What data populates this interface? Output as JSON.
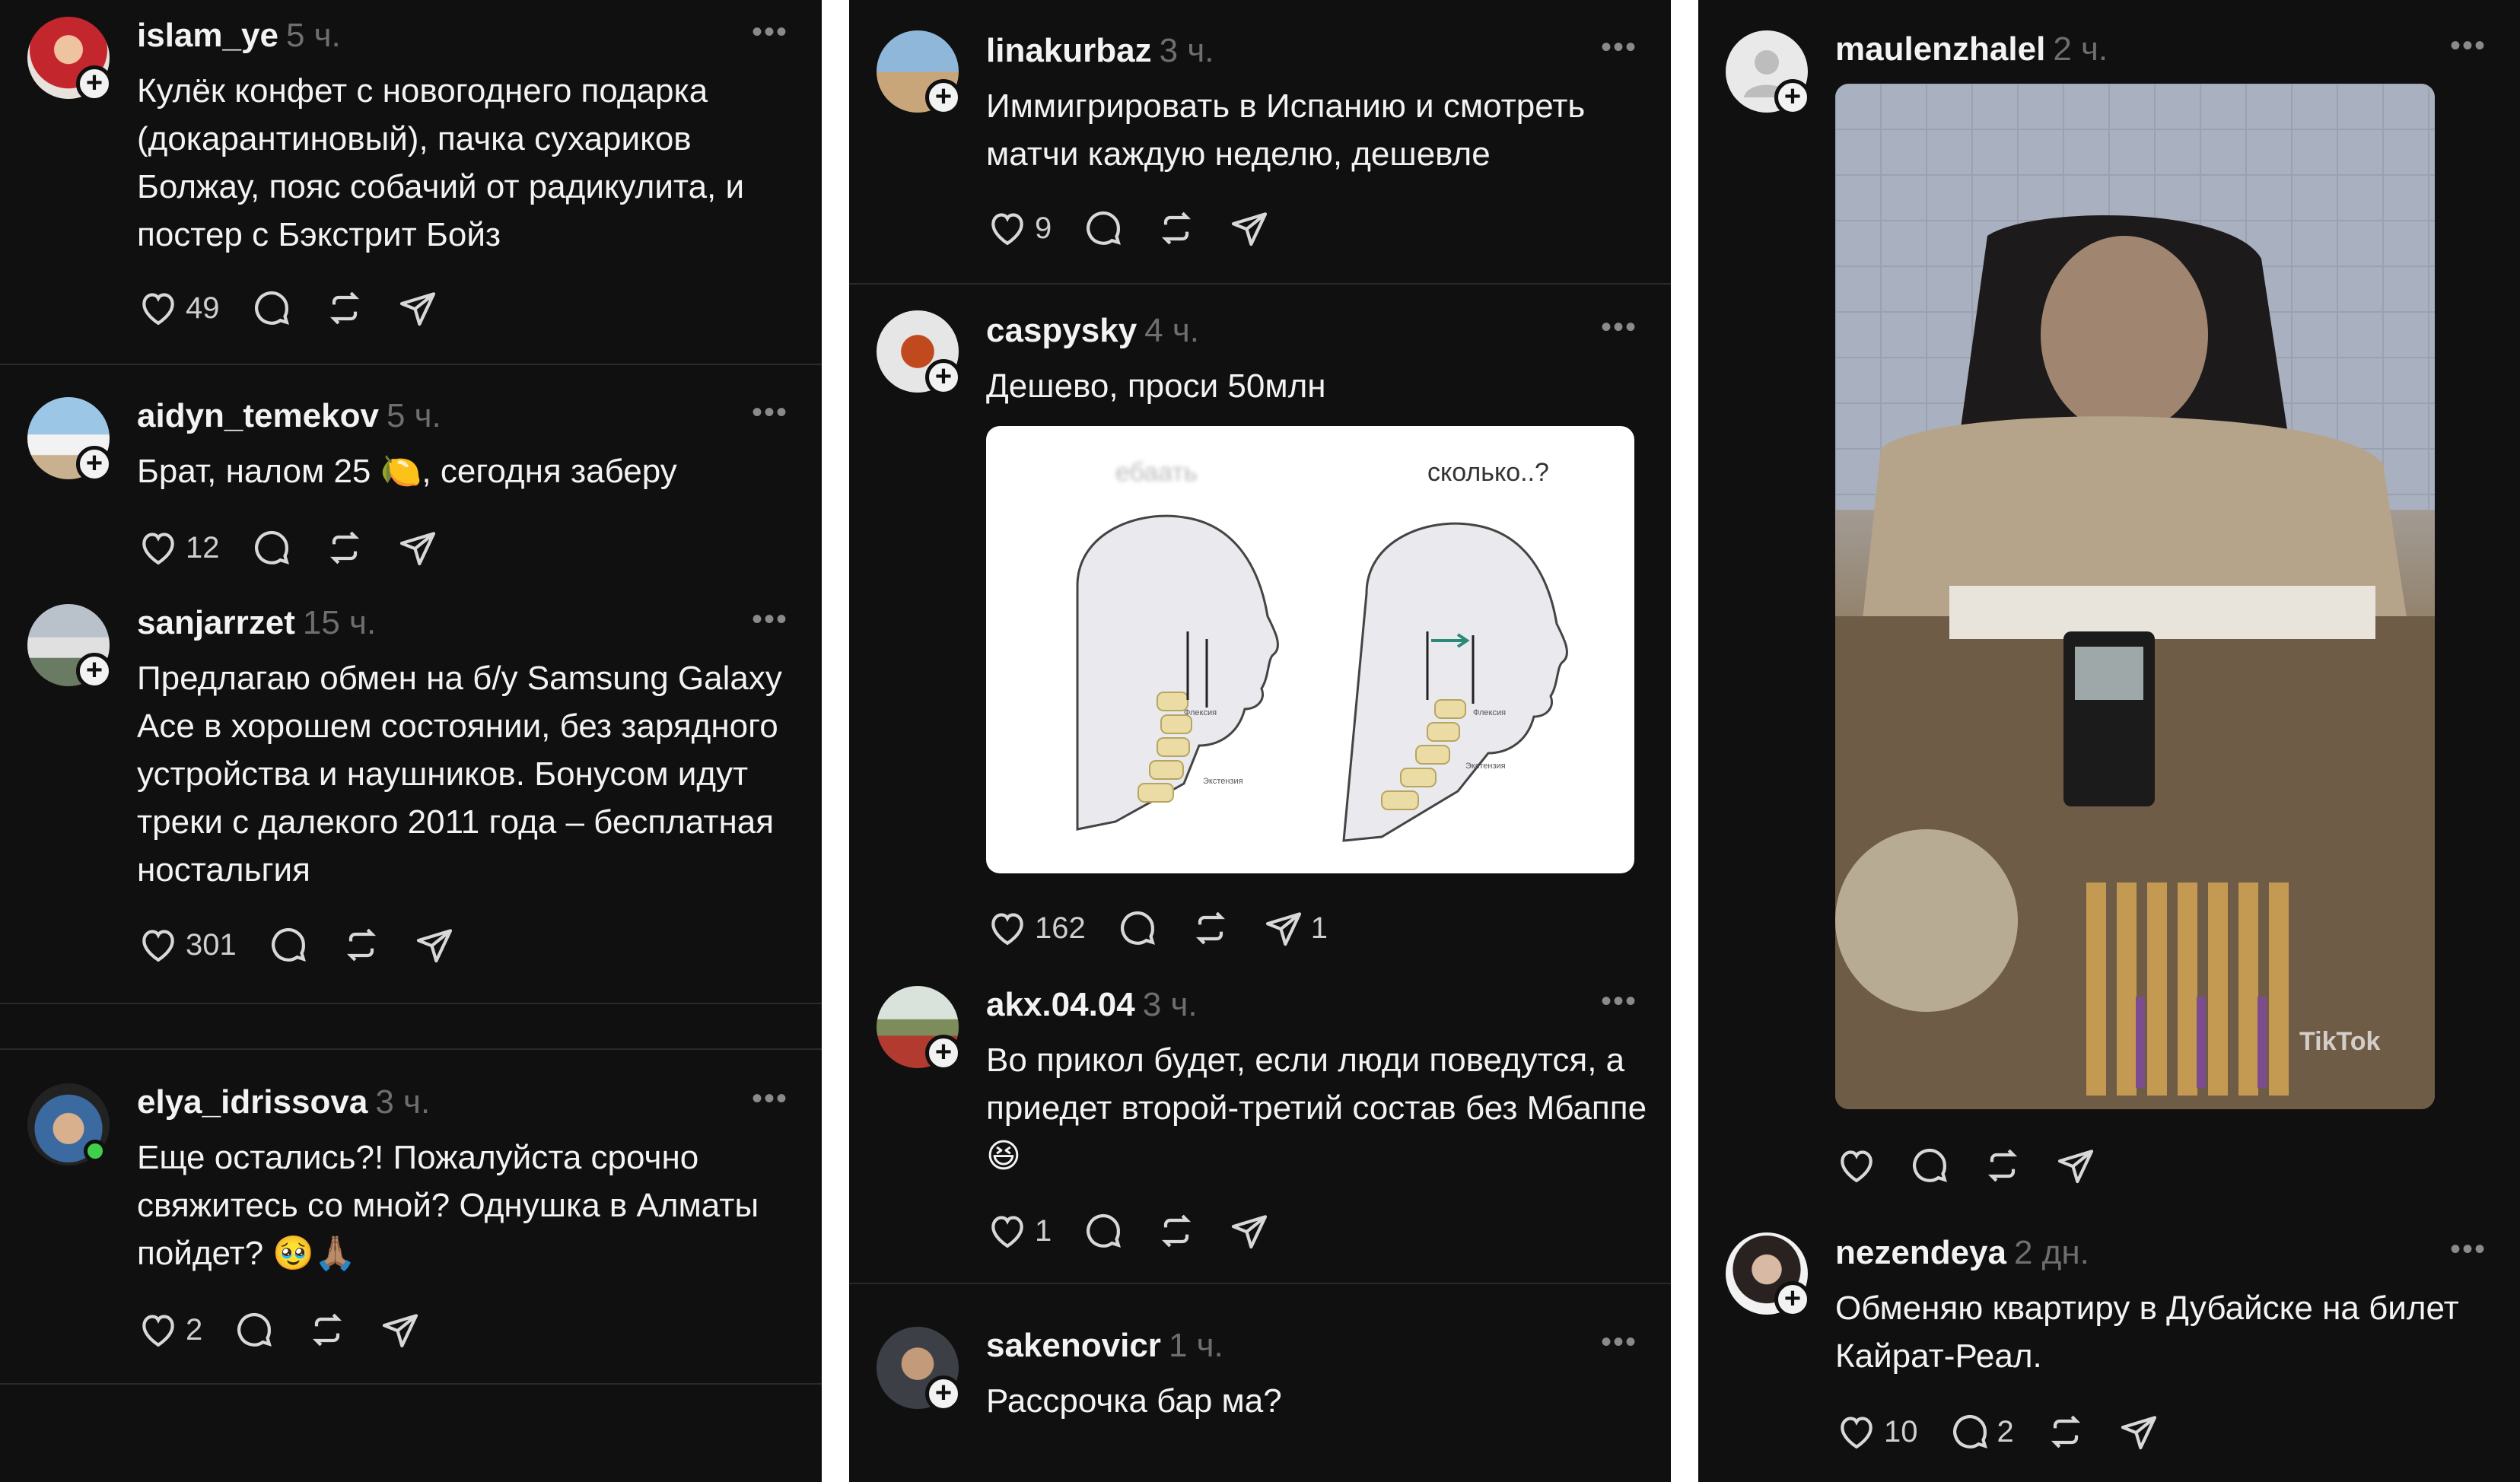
{
  "colors": {
    "background": "#101010",
    "text": "#f3f3f3",
    "muted": "#6e6e6e",
    "separator": "#2a2a2a",
    "online": "#3fcf4a"
  },
  "icons": [
    "heart-icon",
    "comment-icon",
    "repost-icon",
    "send-icon",
    "more-icon",
    "follow-plus-icon"
  ],
  "columns": [
    {
      "posts": [
        {
          "username": "islam_ye",
          "time": "5 ч.",
          "more": "•••",
          "text": "Кулёк конфет с новогоднего подарка (докарантиновый), пачка сухариков Болжау, пояс собачий от радикулита, и постер с Бэкстрит Бойз",
          "likes": "49"
        },
        {
          "username": "aidyn_temekov",
          "time": "5 ч.",
          "more": "•••",
          "text": "Брат, налом 25 🍋, сегодня заберу",
          "likes": "12"
        },
        {
          "username": "sanjarrzet",
          "time": "15 ч.",
          "more": "•••",
          "text": "Предлагаю обмен на б/у Samsung Galaxy Ace в хорошем состоянии, без зарядного устройства и наушников. Бонусом идут треки с далекого 2011 года – бесплатная ностальгия",
          "likes": "301"
        },
        {
          "username": "elya_idrissova",
          "time": "3 ч.",
          "more": "•••",
          "text": "Еще остались?! Пожалуйста срочно свяжитесь со мной? Однушка в Алматы пойдет? 🥹🙏🏽",
          "likes": "2"
        }
      ]
    },
    {
      "posts": [
        {
          "username": "linakurbaz",
          "time": "3 ч.",
          "more": "•••",
          "text": "Иммигрировать в Испанию и смотреть матчи каждую неделю, дешевле",
          "likes": "9"
        },
        {
          "username": "caspysky",
          "time": "4 ч.",
          "more": "•••",
          "text": "Дешево, проси 50млн",
          "likes": "162",
          "shares": "1",
          "image": {
            "label_left": "ебаать",
            "label_right": "сколько..?",
            "caption_a": "Флексия",
            "caption_b": "Экстензия"
          }
        },
        {
          "username": "akx.04.04",
          "time": "3 ч.",
          "more": "•••",
          "text": "Во прикол будет, если люди поведутся, а приедет второй-третий состав без Мбаппе😆",
          "likes": "1"
        },
        {
          "username": "sakenovicr",
          "time": "1 ч.",
          "more": "•••",
          "text": "Рассрочка бар ма?"
        }
      ]
    },
    {
      "posts": [
        {
          "username": "maulenzhalel",
          "time": "2 ч.",
          "more": "•••",
          "watermark": "TikTok"
        },
        {
          "username": "nezendeya",
          "time": "2 дн.",
          "more": "•••",
          "text": "Обменяю  квартиру в Дубайске на билет Кайрат-Реал.",
          "likes": "10",
          "comments": "2"
        }
      ]
    }
  ]
}
